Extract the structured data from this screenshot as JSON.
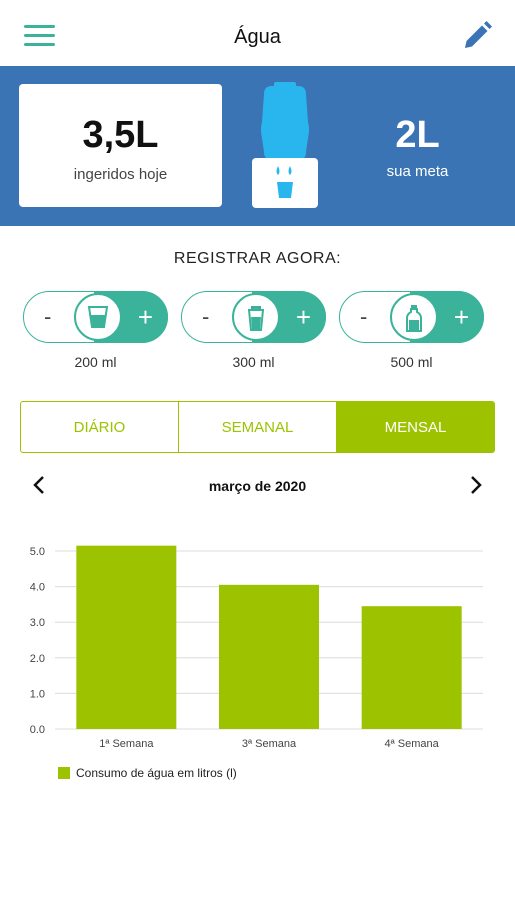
{
  "header": {
    "title": "Água"
  },
  "summary": {
    "intake_value": "3,5L",
    "intake_label": "ingeridos hoje",
    "goal_value": "2L",
    "goal_label": "sua meta"
  },
  "register": {
    "title": "REGISTRAR AGORA:",
    "items": [
      {
        "label": "200 ml",
        "icon": "glass-icon"
      },
      {
        "label": "300 ml",
        "icon": "cup-icon"
      },
      {
        "label": "500 ml",
        "icon": "bottle-icon"
      }
    ],
    "minus": "-",
    "plus": "+"
  },
  "tabs": [
    {
      "label": "DIÁRIO",
      "active": false
    },
    {
      "label": "SEMANAL",
      "active": false
    },
    {
      "label": "MENSAL",
      "active": true
    }
  ],
  "month": {
    "label": "março de 2020"
  },
  "colors": {
    "brand_blue": "#3a74b4",
    "teal": "#3bb39a",
    "lime": "#9cc200",
    "cooler_blue": "#29b6ee"
  },
  "chart_data": {
    "type": "bar",
    "categories": [
      "1ª Semana",
      "3ª Semana",
      "4ª Semana"
    ],
    "series": [
      {
        "name": "Consumo de água em litros (l)",
        "values": [
          5.15,
          4.05,
          3.45
        ]
      }
    ],
    "ylim": [
      0,
      5
    ],
    "yticks": [
      "0.0",
      "1.0",
      "2.0",
      "3.0",
      "4.0",
      "5.0"
    ],
    "grid": true,
    "legend": "bottom-left"
  }
}
